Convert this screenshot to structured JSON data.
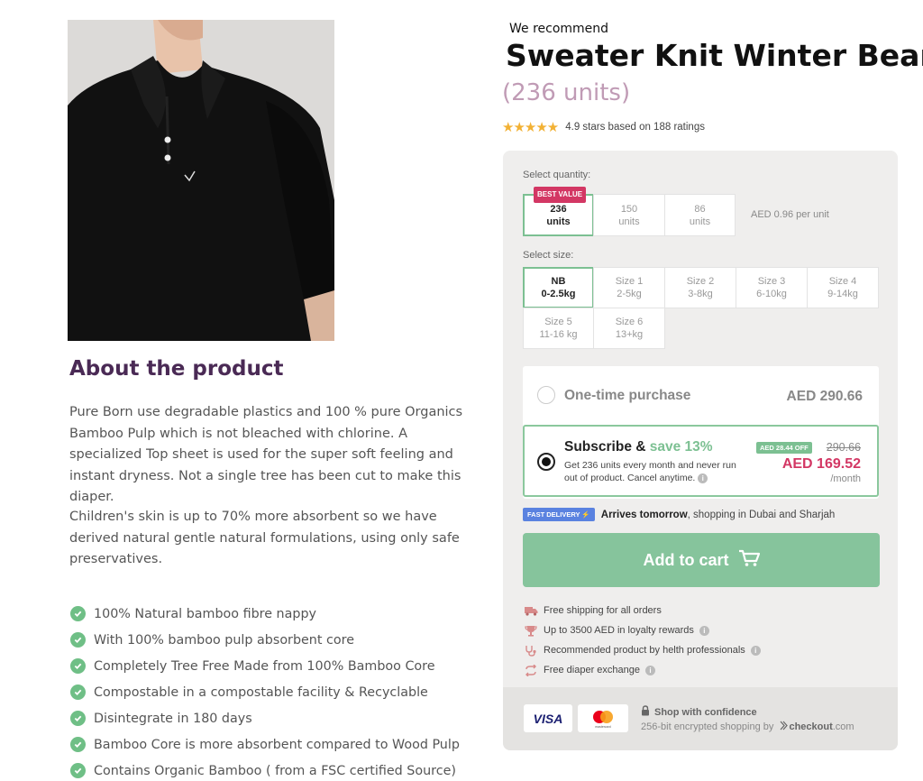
{
  "product": {
    "recommend_label": "We recommend",
    "title": "Sweater Knit Winter Bear",
    "units_subtitle": "(236 units)",
    "rating_text": "4.9 stars based on 188 ratings",
    "stars": "★★★★★"
  },
  "about": {
    "title": "About the product",
    "paragraph1": "Pure Born use degradable plastics and 100 % pure Organics Bamboo Pulp which is not bleached with chlorine. A specialized Top sheet is used for the super soft feeling and instant dryness. Not a single tree has been cut to make this diaper.",
    "paragraph2": "Children's skin is up to 70% more absorbent so we have derived natural gentle natural formulations, using only safe preservatives.",
    "features": [
      "100% Natural bamboo fibre nappy",
      "With 100% bamboo pulp absorbent core",
      "Completely Tree Free Made from 100% Bamboo Core",
      "Compostable in a compostable facility & Recyclable",
      "Disintegrate in 180 days",
      "Bamboo Core is more absorbent compared to Wood Pulp",
      "Contains Organic Bamboo ( from a FSC certified Source)"
    ]
  },
  "quantity": {
    "label": "Select quantity:",
    "best_value_badge": "BEST VALUE",
    "options": [
      {
        "value": "236",
        "unit": "units"
      },
      {
        "value": "150",
        "unit": "units"
      },
      {
        "value": "86",
        "unit": "units"
      }
    ],
    "per_unit": "AED 0.96 per unit"
  },
  "size": {
    "label": "Select size:",
    "options": [
      {
        "name": "NB",
        "range": "0-2.5kg"
      },
      {
        "name": "Size 1",
        "range": "2-5kg"
      },
      {
        "name": "Size 2",
        "range": "3-8kg"
      },
      {
        "name": "Size 3",
        "range": "6-10kg"
      },
      {
        "name": "Size 4",
        "range": "9-14kg"
      },
      {
        "name": "Size 5",
        "range": "11-16 kg"
      },
      {
        "name": "Size 6",
        "range": "13+kg"
      }
    ]
  },
  "purchase": {
    "onetime_label": "One-time purchase",
    "onetime_price": "AED 290.66",
    "subscribe_label": "Subscribe &",
    "subscribe_save": "save 13%",
    "subscribe_desc": "Get 236 units every month and never run out of product. Cancel anytime.",
    "off_badge": "AED 28.44 OFF",
    "old_price": "290.66",
    "new_price": "AED 169.52",
    "per_month": "/month"
  },
  "delivery": {
    "badge": "FAST DELIVERY ⚡",
    "bold": "Arrives tomorrow",
    "rest": ", shopping in Dubai and Sharjah"
  },
  "cart": {
    "label": "Add to cart"
  },
  "perks": [
    "Free shipping for all orders",
    "Up to 3500 AED in loyalty rewards",
    "Recommended product by helth professionals",
    "Free diaper exchange"
  ],
  "payment": {
    "visa": "VISA",
    "mastercard_caption": "mastercard",
    "confidence_title": "Shop with confidence",
    "confidence_sub": "256-bit encrypted shopping by",
    "checkout_brand": "checkout",
    "checkout_tld": ".com"
  },
  "colors": {
    "accent_green": "#7cc092",
    "price_pink": "#d33764",
    "heading_purple": "#4a2a55",
    "star_gold": "#f2b134",
    "delivery_blue": "#5a82e0"
  }
}
